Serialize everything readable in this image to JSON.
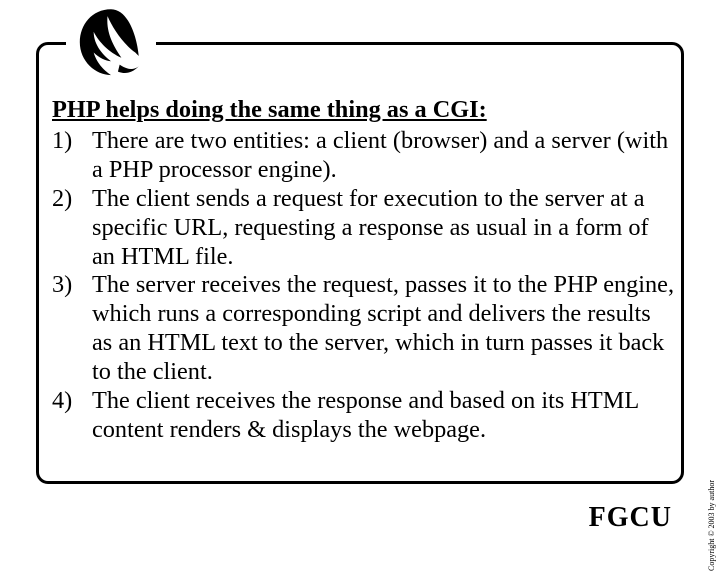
{
  "heading": "PHP helps doing the same thing as a CGI:",
  "items": [
    {
      "num": "1)",
      "text": "There are two entities: a client (browser) and a server (with a PHP processor engine)."
    },
    {
      "num": "2)",
      "text": "The client sends a request for execution to the server at a specific URL, requesting a response as usual in a form of an HTML file."
    },
    {
      "num": "3)",
      "text": "The server receives the request, passes it to the PHP engine, which runs a corresponding script and delivers the results as an HTML text to the server, which in turn passes it back to the client."
    },
    {
      "num": "4)",
      "text": "The client receives the response and based on its HTML content renders & displays the webpage."
    }
  ],
  "footer": "FGCU",
  "copyright": "Copyright © 2003 by author"
}
